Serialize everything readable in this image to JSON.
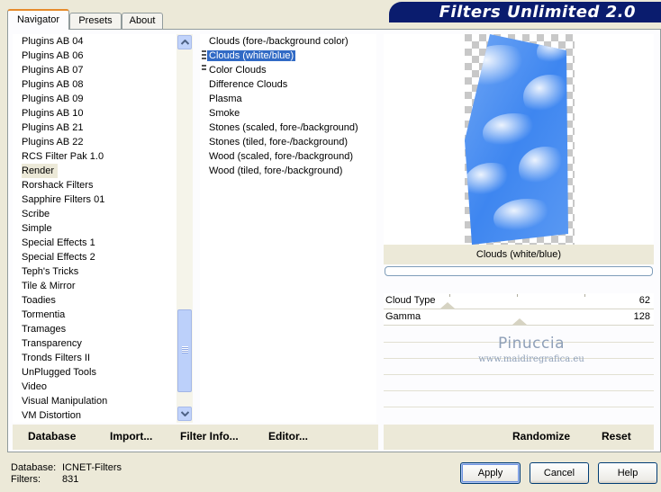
{
  "tabs": [
    {
      "label": "Navigator",
      "active": true
    },
    {
      "label": "Presets",
      "active": false
    },
    {
      "label": "About",
      "active": false
    }
  ],
  "app_title": "Filters Unlimited 2.0",
  "categories": [
    "Plugins AB 04",
    "Plugins AB 06",
    "Plugins AB 07",
    "Plugins AB 08",
    "Plugins AB 09",
    "Plugins AB 10",
    "Plugins AB 21",
    "Plugins AB 22",
    "RCS Filter Pak 1.0",
    "Render",
    "Rorshack Filters",
    "Sapphire Filters 01",
    "Scribe",
    "Simple",
    "Special Effects 1",
    "Special Effects 2",
    "Teph's Tricks",
    "Tile & Mirror",
    "Toadies",
    "Tormentia",
    "Tramages",
    "Transparency",
    "Tronds Filters II",
    "UnPlugged Tools",
    "Video",
    "Visual Manipulation",
    "VM Distortion"
  ],
  "selected_category": "Render",
  "filters": [
    "Clouds (fore-/background color)",
    "Clouds (white/blue)",
    "Color Clouds",
    "Difference Clouds",
    "Plasma",
    "Smoke",
    "Stones (scaled, fore-/background)",
    "Stones (tiled, fore-/background)",
    "Wood (scaled, fore-/background)",
    "Wood (tiled, fore-/background)"
  ],
  "selected_filter": "Clouds (white/blue)",
  "preview_caption": "Clouds (white/blue)",
  "params": [
    {
      "label": "Cloud Type",
      "value": "62"
    },
    {
      "label": "Gamma",
      "value": "128"
    }
  ],
  "watermark": {
    "line1": "Pinuccia",
    "line2": "www.maidiregrafica.eu"
  },
  "toolbar": {
    "database": "Database",
    "import": "Import...",
    "filter_info": "Filter Info...",
    "editor": "Editor...",
    "randomize": "Randomize",
    "reset": "Reset"
  },
  "status": {
    "database_key": "Database:",
    "database_val": "ICNET-Filters",
    "filters_key": "Filters:",
    "filters_val": "831"
  },
  "buttons": {
    "apply": "Apply",
    "cancel": "Cancel",
    "help": "Help"
  },
  "colors": {
    "banner": "#0A1C6E",
    "selection": "#316AC5",
    "cloud_blue": "#3F86F0"
  }
}
